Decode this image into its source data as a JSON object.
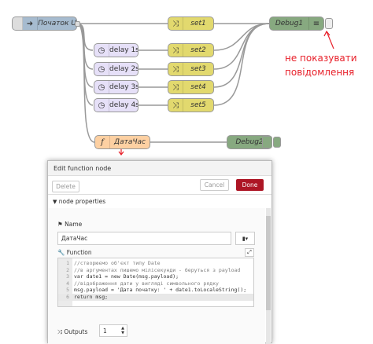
{
  "flow": {
    "inject_label": "Початок U",
    "delays": [
      "delay 1s",
      "delay 2s",
      "delay 3s",
      "delay 4s"
    ],
    "sets": [
      "set1",
      "set2",
      "set3",
      "set4",
      "set5"
    ],
    "debug1_label": "Debug1",
    "debug2_label": "Debug2",
    "function_label": "ДатаЧас",
    "annotation_line1": "не показувати",
    "annotation_line2": "повідомлення"
  },
  "dialog": {
    "title": "Edit function node",
    "delete_label": "Delete",
    "cancel_label": "Cancel",
    "done_label": "Done",
    "section_label": "node properties",
    "name_label": "Name",
    "name_value": "ДатаЧас",
    "function_label": "Function",
    "code_lines": [
      {
        "n": "1",
        "text": "//створюємо об'єкт типу Date",
        "cls": "c-comment"
      },
      {
        "n": "2",
        "text": "//в аргументах пишемо мілісекунди - беруться з payload",
        "cls": "c-comment"
      },
      {
        "n": "3",
        "text": "var date1 = new Date(msg.payload);",
        "cls": "c-var"
      },
      {
        "n": "4",
        "text": "//відображення дати у вигляді символьного рядку",
        "cls": "c-comment"
      },
      {
        "n": "5",
        "text": "msg.payload = 'Дата початку: ' + date1.toLocaleString();",
        "cls": "c-var"
      },
      {
        "n": "6",
        "text": "return msg;",
        "cls": "c-var"
      }
    ],
    "outputs_label": "Outputs",
    "outputs_value": "1"
  },
  "colors": {
    "inject": "#a6bbcf",
    "delay": "#e6e0f8",
    "change": "#e2d96e",
    "debug": "#87a980",
    "function": "#fdd0a2",
    "annotation": "#e8202a",
    "done_button": "#ad1625"
  }
}
